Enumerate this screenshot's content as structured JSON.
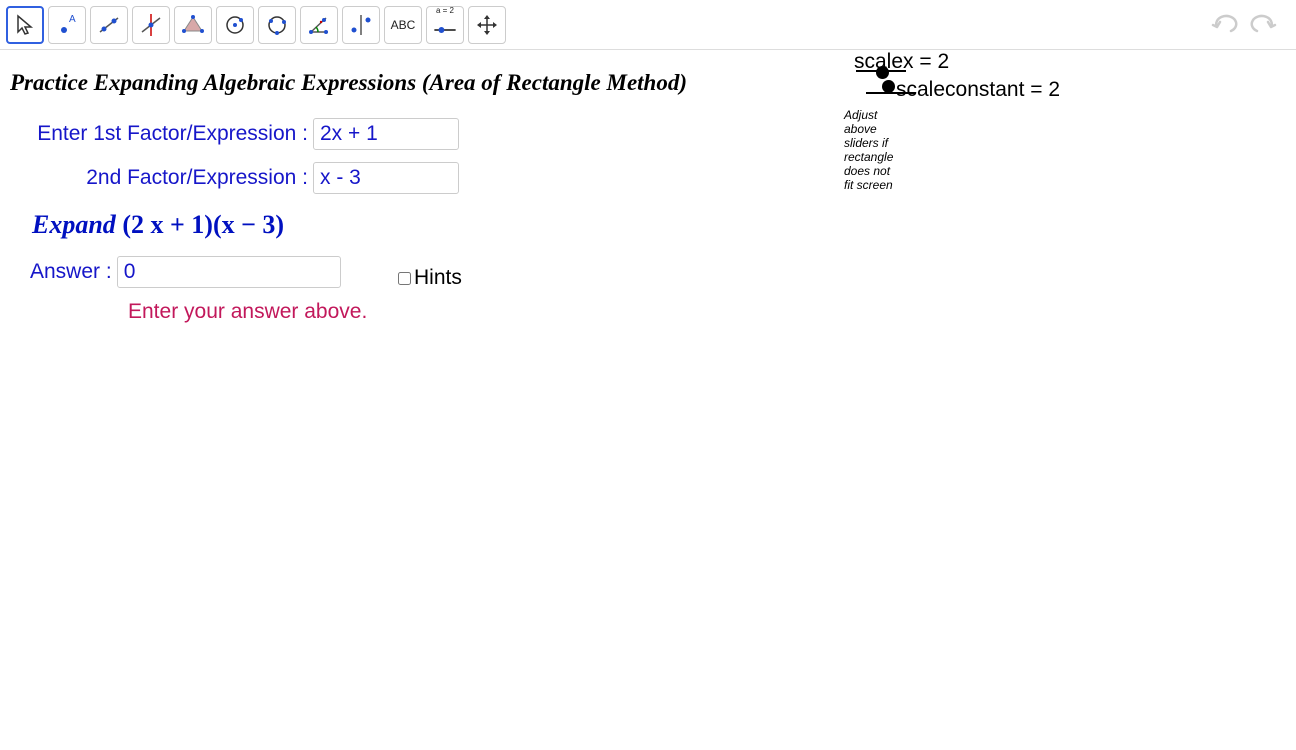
{
  "title": "Practice Expanding Algebraic Expressions (Area of Rectangle Method)",
  "sliders": {
    "scalex_label": "scalex = 2",
    "scaleconstant_label": "scaleconstant = 2",
    "hint": "Adjust above sliders if rectangle does not fit screen"
  },
  "inputs": {
    "factor1_label": "Enter 1st Factor/Expression  :",
    "factor1_value": "2x + 1",
    "factor2_label": "2nd Factor/Expression  :",
    "factor2_value": "x - 3",
    "answer_label": "Answer :",
    "answer_value": "0"
  },
  "expand_prefix": "Expand ",
  "expand_expression_p1": "(2 x + 1)",
  "expand_expression_p2": "(x − 3)",
  "hints_label": "Hints",
  "feedback": "Enter your answer above.",
  "toolbar": {
    "abc": "ABC",
    "slider_eq": "a = 2"
  }
}
